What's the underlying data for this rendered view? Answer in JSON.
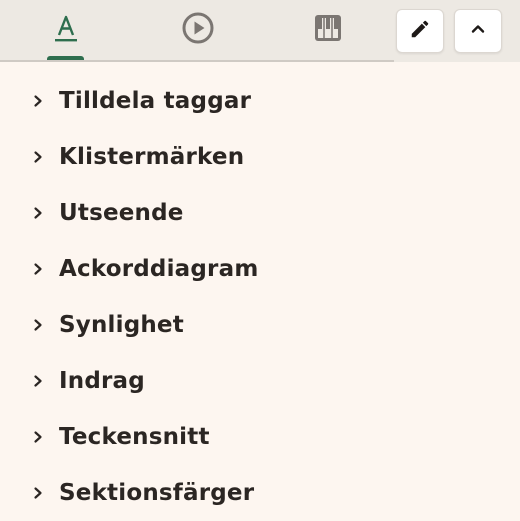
{
  "tabs": [
    {
      "icon": "text-format-icon",
      "selected": true
    },
    {
      "icon": "play-circle-icon",
      "selected": false
    },
    {
      "icon": "piano-keys-icon",
      "selected": false
    }
  ],
  "toolbar": {
    "edit_icon": "pencil-icon",
    "collapse_icon": "chevron-up-icon"
  },
  "colors": {
    "accent": "#2e6e4e",
    "background": "#fdf6f0",
    "topbar": "#ede9e3",
    "text": "#2b2623"
  },
  "sections": [
    {
      "label": "Tilldela taggar"
    },
    {
      "label": "Klistermärken"
    },
    {
      "label": "Utseende"
    },
    {
      "label": "Ackorddiagram"
    },
    {
      "label": "Synlighet"
    },
    {
      "label": "Indrag"
    },
    {
      "label": "Teckensnitt"
    },
    {
      "label": "Sektionsfärger"
    }
  ]
}
